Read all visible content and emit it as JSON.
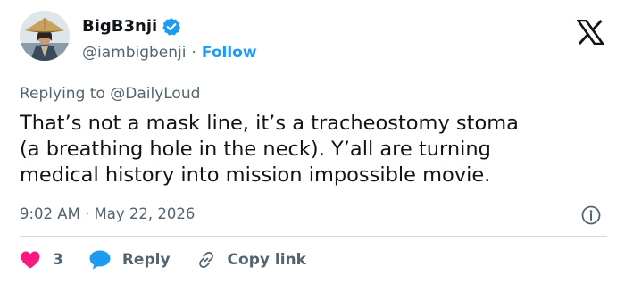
{
  "colors": {
    "accent": "#1d9bf0",
    "secondary_text": "#536471",
    "primary_text": "#0f1419",
    "like": "#f91880",
    "divider": "#cfd9de"
  },
  "author": {
    "display_name": "BigB3nji",
    "handle": "@iambigbenji",
    "separator": "·",
    "follow_label": "Follow",
    "verified_icon": "verified-badge-icon",
    "avatar_icon": "profile-avatar"
  },
  "platform_icon": "x-logo-icon",
  "reply_context": {
    "prefix": "Replying to ",
    "mention": "@DailyLoud"
  },
  "tweet": {
    "text": "That’s not a mask line, it’s a tracheostomy stoma\n(a breathing hole in the neck). Y’all are turning\nmedical history into mission impossible movie.",
    "timestamp": "9:02 AM · May 22, 2026"
  },
  "actions": {
    "like_count": "3",
    "reply_label": "Reply",
    "copy_link_label": "Copy link"
  }
}
